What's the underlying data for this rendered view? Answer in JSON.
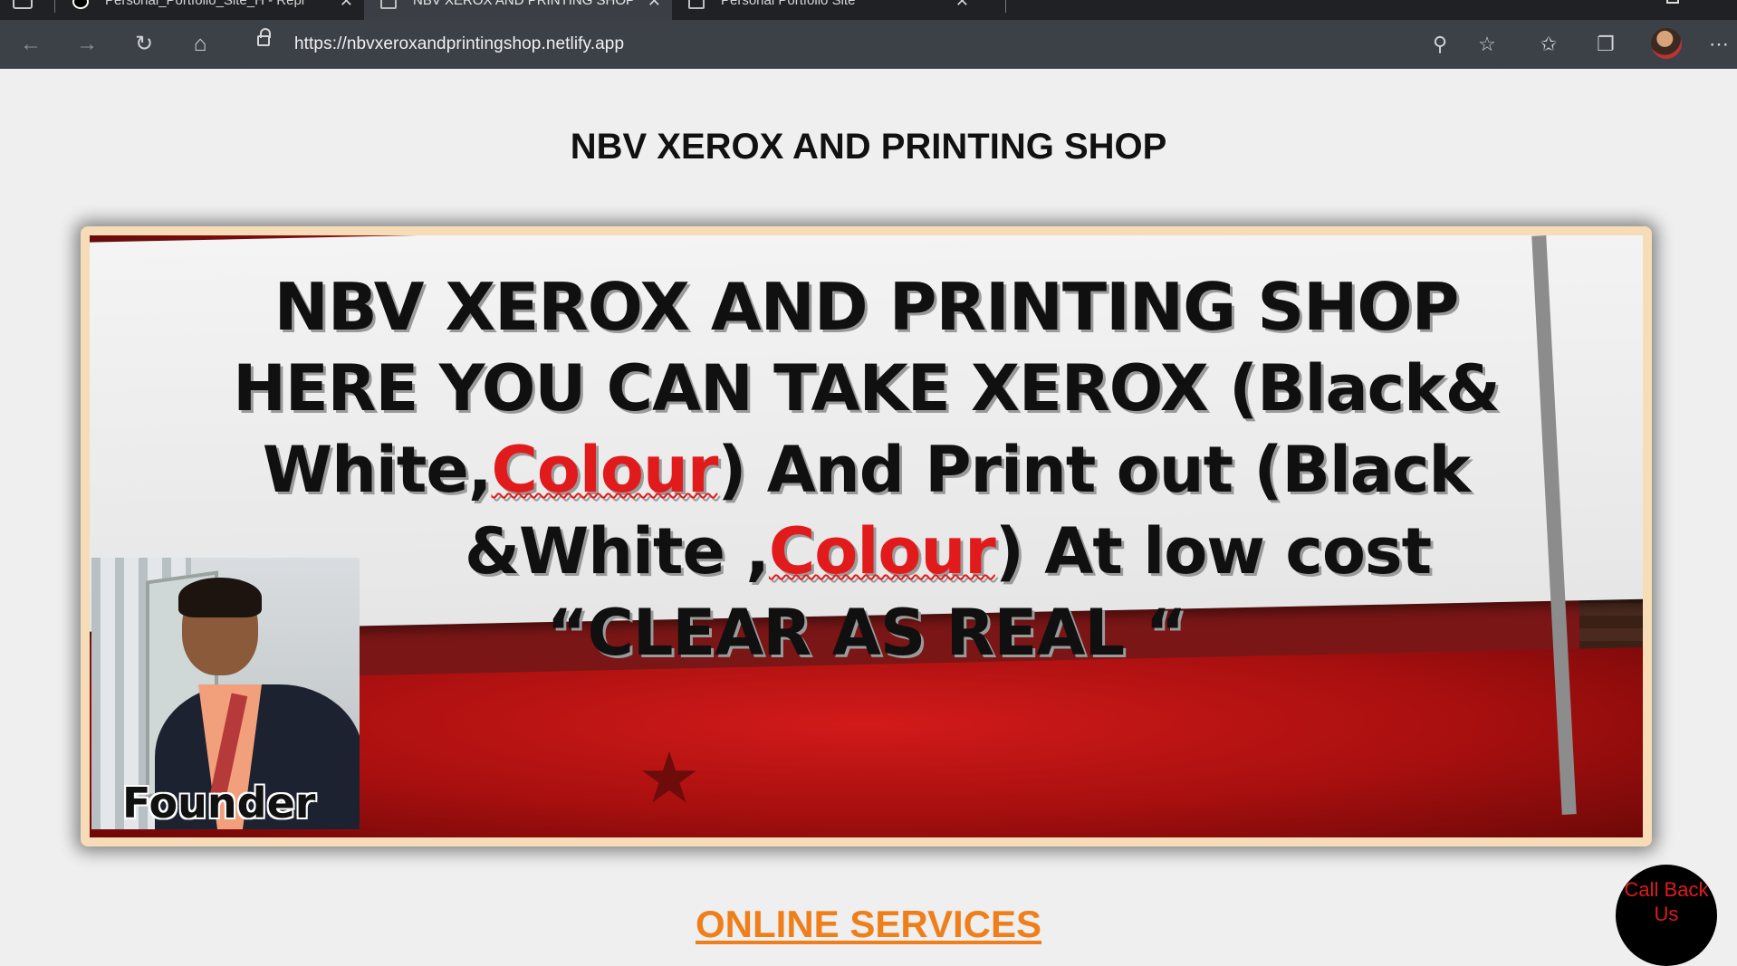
{
  "browser": {
    "tabs": [
      {
        "title": "Personal_Portfolio_Site_H - Repl"
      },
      {
        "title": "NBV XEROX AND PRINTING SHOP"
      },
      {
        "title": "Personal Portfolio Site"
      }
    ],
    "address_url": "https://nbvxeroxandprintingshop.netlify.app",
    "icons": {
      "back": "arrow-left",
      "forward": "arrow-right",
      "refresh": "refresh",
      "home": "home",
      "zoom": "zoom-out",
      "add_favorite": "star-plus",
      "favorites": "star-list",
      "collections": "collections",
      "profile": "avatar",
      "more": "ellipsis"
    }
  },
  "page": {
    "title": "NBV XEROX AND PRINTING SHOP",
    "banner": {
      "line1": "NBV XEROX AND PRINTING SHOP",
      "line2": "HERE YOU CAN TAKE XEROX (Black&",
      "line3a": "White,",
      "line3b": "Colour",
      "line3c": ") And Print out (Black",
      "line4a": "&White ,",
      "line4b": "Colour",
      "line4c": ") At low cost",
      "line5": "“CLEAR AS REAL “",
      "founder_label": "Founder"
    },
    "section_title": "ONLINE SERVICES",
    "callback_button": "Call Back Us"
  },
  "colors": {
    "accent_orange": "#ee7f1b",
    "banner_red": "#e11b1b",
    "callback_text": "#e01a1a"
  }
}
